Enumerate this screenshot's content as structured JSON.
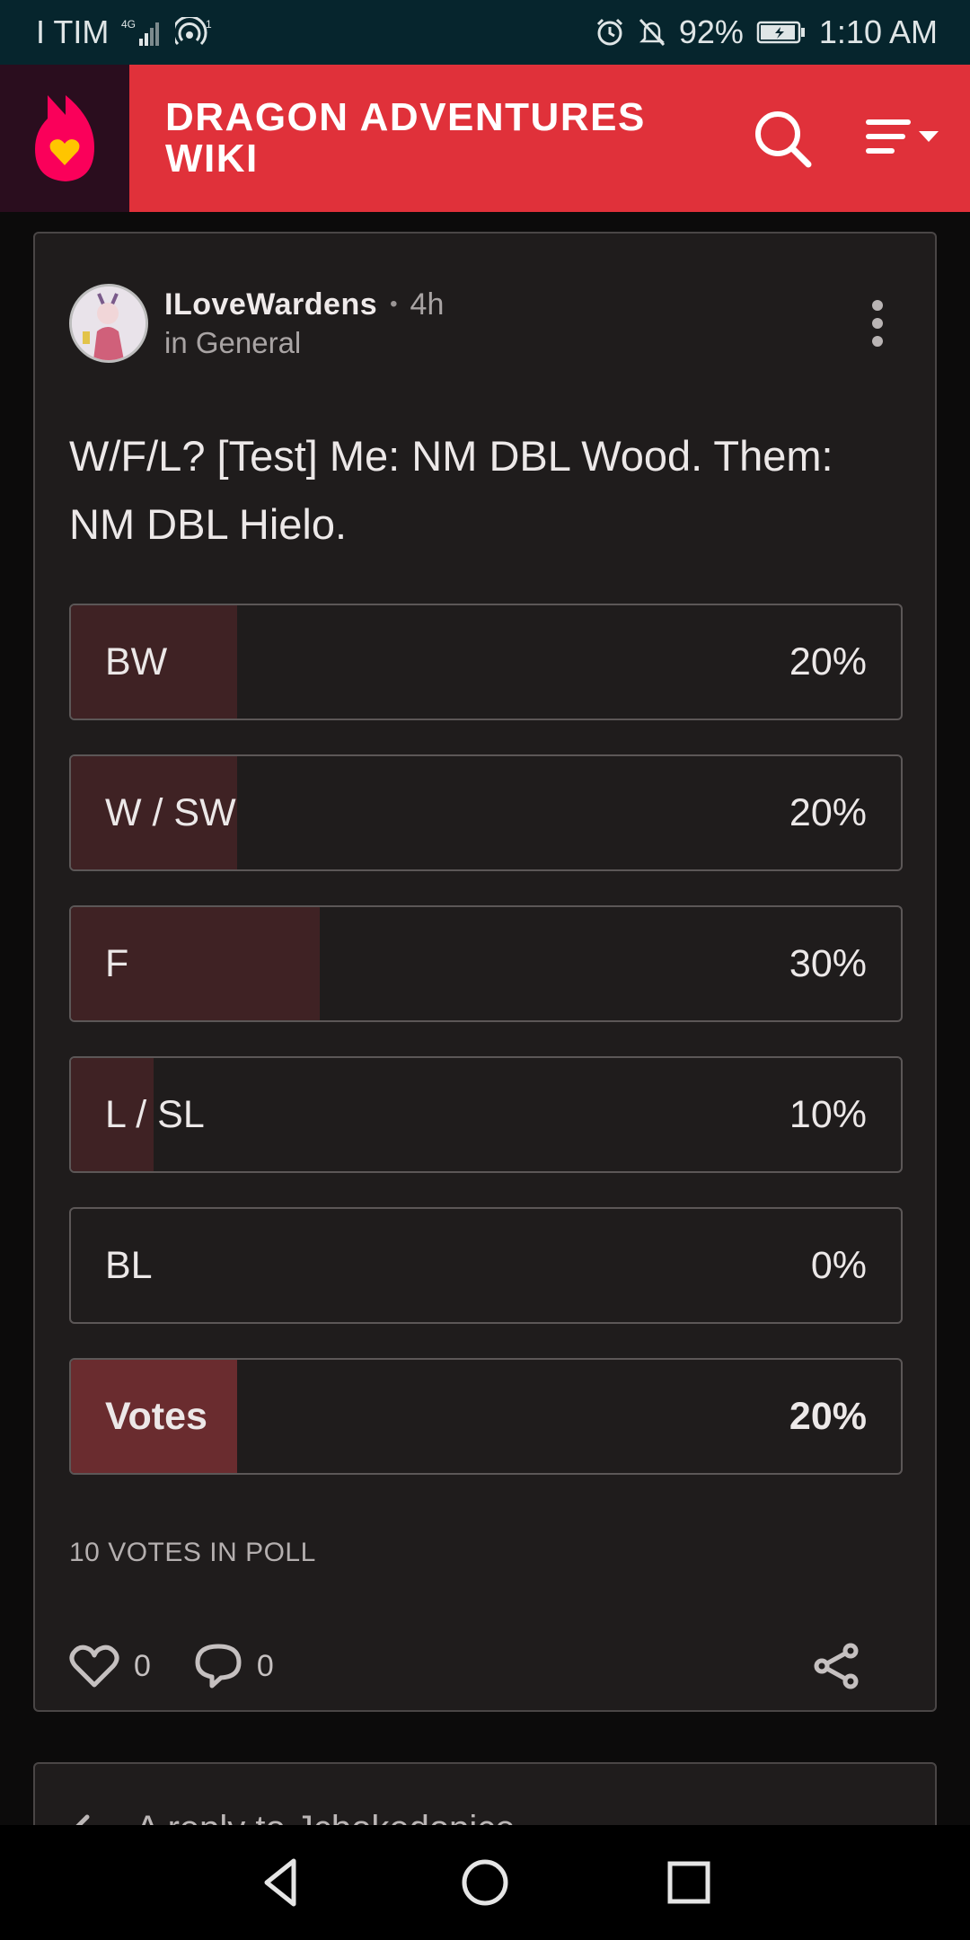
{
  "status_bar": {
    "carrier": "I TIM",
    "network": "4G",
    "hotspot_count": "1",
    "battery": "92%",
    "time": "1:10 AM"
  },
  "header": {
    "title": "DRAGON ADVENTURES WIKI",
    "brand_color": "#e0313a",
    "icons": [
      "fandom-logo-icon",
      "search-icon",
      "menu-icon"
    ]
  },
  "post": {
    "author": "ILoveWardens",
    "time": "4h",
    "category": "in General",
    "title": "W/F/L? [Test] Me: NM DBL Wood. Them: NM DBL Hielo.",
    "poll": {
      "options": [
        {
          "label": "BW",
          "percent": "20%",
          "fraction": 0.2,
          "selected": false
        },
        {
          "label": "W / SW",
          "percent": "20%",
          "fraction": 0.2,
          "selected": false
        },
        {
          "label": "F",
          "percent": "30%",
          "fraction": 0.3,
          "selected": false
        },
        {
          "label": "L / SL",
          "percent": "10%",
          "fraction": 0.1,
          "selected": false
        },
        {
          "label": "BL",
          "percent": "0%",
          "fraction": 0.0,
          "selected": false
        },
        {
          "label": "Votes",
          "percent": "20%",
          "fraction": 0.2,
          "selected": true
        }
      ],
      "votes_text": "10 VOTES IN POLL"
    },
    "likes": "0",
    "comments": "0"
  },
  "reply": {
    "text": "A reply to Jcbokedopice"
  },
  "nav": [
    "back-icon",
    "home-icon",
    "recents-icon"
  ]
}
